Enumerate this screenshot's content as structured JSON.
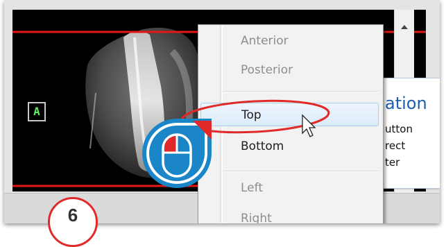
{
  "viewer": {
    "orientation_label": "A",
    "accent_line_color": "#e01818"
  },
  "context_menu": {
    "items": [
      {
        "label": "Anterior",
        "enabled": false
      },
      {
        "label": "Posterior",
        "enabled": false
      },
      {
        "label": "Top",
        "enabled": true,
        "highlighted": true
      },
      {
        "label": "Bottom",
        "enabled": true
      },
      {
        "label": "Left",
        "enabled": false
      },
      {
        "label": "Right",
        "enabled": false
      }
    ]
  },
  "side_panel": {
    "title": "ation",
    "lines": [
      "utton",
      "rect",
      "ter"
    ],
    "title_color": "#1b5fae"
  },
  "callout": {
    "step_number": "6",
    "ring_color": "#e02a2a",
    "mouse_badge_color": "#1a86c8",
    "icon": "mouse-left-click-icon"
  }
}
